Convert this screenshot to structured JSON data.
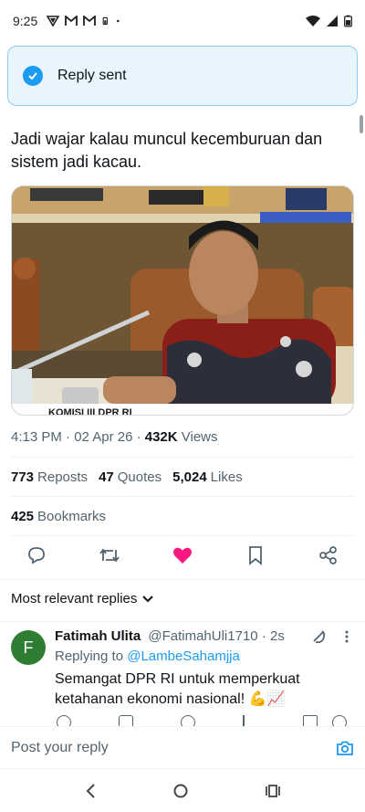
{
  "status_bar": {
    "time": "9:25",
    "notification_icons": [
      "vpn-icon",
      "gmail-icon",
      "gmail-icon",
      "battery-saver-icon",
      "dot-icon"
    ],
    "system_icons": [
      "wifi-icon",
      "signal-icon",
      "battery-icon"
    ]
  },
  "toast": {
    "label": "Reply sent"
  },
  "tweet": {
    "text": "Jadi wajar kalau muncul kecemburuan dan sistem jadi kacau.",
    "media_caption": "KOMISI III DPR RI",
    "timestamp": "4:13 PM · 02 Apr 26 · ",
    "views_count": "432K",
    "views_label": " Views",
    "reposts_count": "773",
    "reposts_label": "Reposts",
    "quotes_count": "47",
    "quotes_label": "Quotes",
    "likes_count": "5,024",
    "likes_label": "Likes",
    "bookmarks_count": "425",
    "bookmarks_label": "Bookmarks"
  },
  "actions": [
    "reply-icon",
    "repost-icon",
    "like-icon",
    "bookmark-icon",
    "share-icon"
  ],
  "colors": {
    "accent": "#1d9bf0",
    "like": "#f91880",
    "muted": "#536471",
    "avatar": "#2e7d32"
  },
  "replies_filter": {
    "label": "Most relevant replies"
  },
  "reply": {
    "avatar_letter": "F",
    "name": "Fatimah Ulita",
    "handle": "@FatimahUli1710",
    "time": "· 2s",
    "replying_prefix": "Replying to ",
    "replying_to": "@LambeSahamjja",
    "text": "Semangat DPR RI untuk memperkuat ketahanan ekonomi nasional! 💪📈"
  },
  "compose": {
    "placeholder": "Post your reply"
  }
}
